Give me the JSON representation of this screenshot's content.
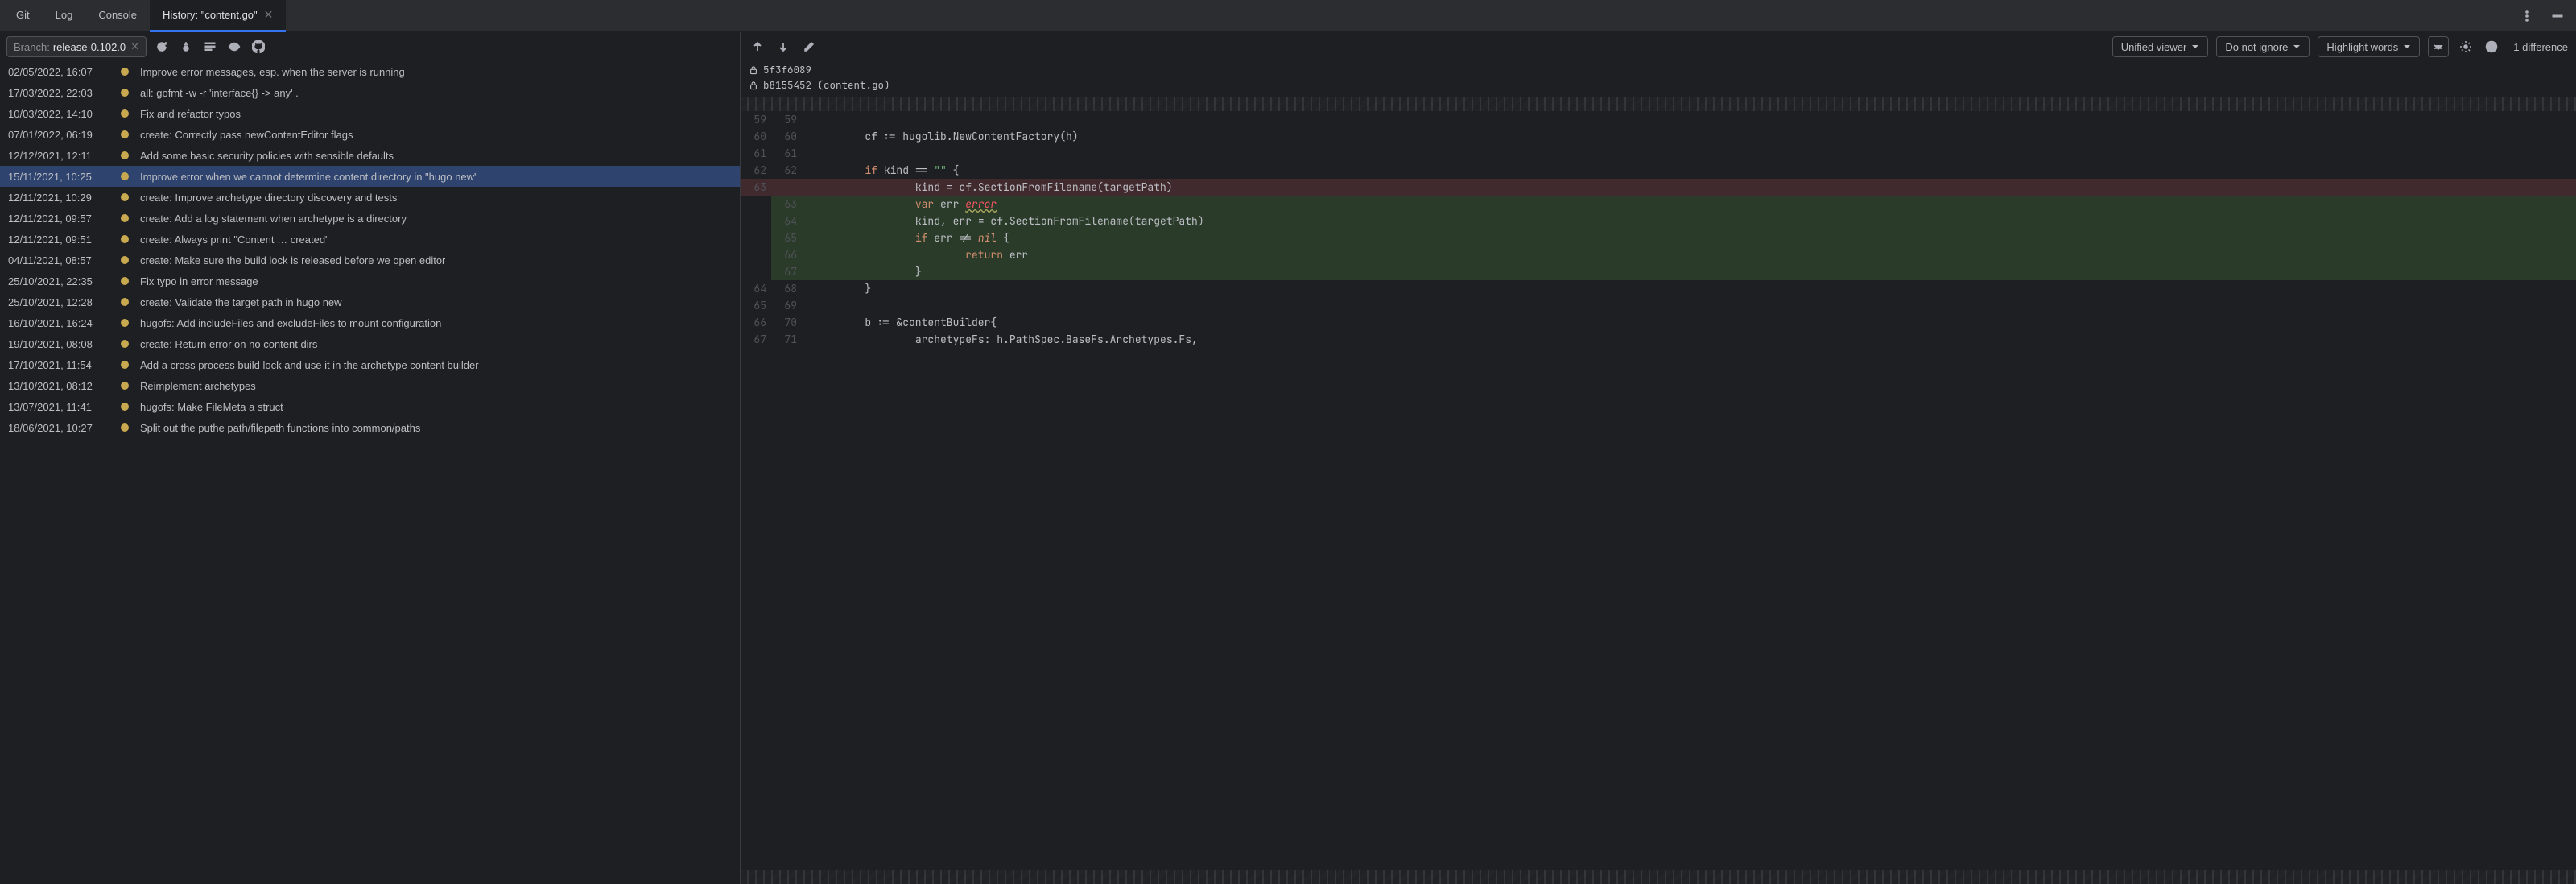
{
  "tabs": [
    {
      "label": "Git",
      "active": false
    },
    {
      "label": "Log",
      "active": false
    },
    {
      "label": "Console",
      "active": false
    },
    {
      "label": "History: \"content.go\"",
      "active": true,
      "closable": true
    }
  ],
  "branch": {
    "label": "Branch:",
    "name": "release-0.102.0"
  },
  "commits": [
    {
      "date": "02/05/2022, 16:07",
      "msg": "Improve error messages, esp. when the server is running"
    },
    {
      "date": "17/03/2022, 22:03",
      "msg": "all: gofmt -w -r 'interface{} -> any' ."
    },
    {
      "date": "10/03/2022, 14:10",
      "msg": "Fix and refactor typos"
    },
    {
      "date": "07/01/2022, 06:19",
      "msg": "create: Correctly pass newContentEditor flags"
    },
    {
      "date": "12/12/2021, 12:11",
      "msg": "Add some basic security policies with sensible defaults"
    },
    {
      "date": "15/11/2021, 10:25",
      "msg": "Improve error when we cannot determine content directory in \"hugo new\"",
      "selected": true
    },
    {
      "date": "12/11/2021, 10:29",
      "msg": "create: Improve archetype directory discovery and tests"
    },
    {
      "date": "12/11/2021, 09:57",
      "msg": "create: Add a log statement when archetype is a directory"
    },
    {
      "date": "12/11/2021, 09:51",
      "msg": "create: Always print \"Content … created\""
    },
    {
      "date": "04/11/2021, 08:57",
      "msg": "create: Make sure the build lock is released before we open editor"
    },
    {
      "date": "25/10/2021, 22:35",
      "msg": "Fix typo in error message"
    },
    {
      "date": "25/10/2021, 12:28",
      "msg": "create: Validate the target path in hugo new"
    },
    {
      "date": "16/10/2021, 16:24",
      "msg": "hugofs: Add includeFiles and excludeFiles to mount configuration"
    },
    {
      "date": "19/10/2021, 08:08",
      "msg": "create: Return error on no content dirs"
    },
    {
      "date": "17/10/2021, 11:54",
      "msg": "Add a cross process build lock and use it in the archetype content builder"
    },
    {
      "date": "13/10/2021, 08:12",
      "msg": "Reimplement archetypes"
    },
    {
      "date": "13/07/2021, 11:41",
      "msg": "hugofs: Make FileMeta a struct"
    },
    {
      "date": "18/06/2021, 10:27",
      "msg": "Split out the puthe path/filepath functions into common/paths"
    }
  ],
  "right_toolbar": {
    "viewer": "Unified viewer",
    "ignore": "Do not ignore",
    "highlight": "Highlight words",
    "diff_count": "1 difference"
  },
  "hashes": {
    "old": "5f3f6089",
    "new": "b8155452 (content.go)"
  },
  "diff_lines": [
    {
      "l": "59",
      "r": "59",
      "type": "ctx",
      "code": ""
    },
    {
      "l": "60",
      "r": "60",
      "type": "ctx",
      "code": "\tcf := hugolib.NewContentFactory(h)"
    },
    {
      "l": "61",
      "r": "61",
      "type": "ctx",
      "code": ""
    },
    {
      "l": "62",
      "r": "62",
      "type": "ctx",
      "code": "\tif kind == \"\" {",
      "tokens": [
        {
          "t": "\t",
          "c": ""
        },
        {
          "t": "if",
          "c": "tok-kw"
        },
        {
          "t": " kind == ",
          "c": ""
        },
        {
          "t": "\"\"",
          "c": "tok-str"
        },
        {
          "t": " {",
          "c": ""
        }
      ]
    },
    {
      "l": "63",
      "r": "",
      "type": "removed",
      "code": "\t\tkind = cf.SectionFromFilename(targetPath)"
    },
    {
      "l": "",
      "r": "63",
      "type": "added",
      "code": "\t\tvar err error",
      "tokens": [
        {
          "t": "\t\t",
          "c": ""
        },
        {
          "t": "var",
          "c": "tok-kw"
        },
        {
          "t": " err ",
          "c": ""
        },
        {
          "t": "error",
          "c": "tok-err"
        }
      ]
    },
    {
      "l": "",
      "r": "64",
      "type": "added",
      "code": "\t\tkind, err = cf.SectionFromFilename(targetPath)"
    },
    {
      "l": "",
      "r": "65",
      "type": "added",
      "code": "\t\tif err != nil {",
      "tokens": [
        {
          "t": "\t\t",
          "c": ""
        },
        {
          "t": "if",
          "c": "tok-kw"
        },
        {
          "t": " err != ",
          "c": ""
        },
        {
          "t": "nil",
          "c": "tok-nil"
        },
        {
          "t": " {",
          "c": ""
        }
      ]
    },
    {
      "l": "",
      "r": "66",
      "type": "added",
      "code": "\t\t\treturn err",
      "tokens": [
        {
          "t": "\t\t\t",
          "c": ""
        },
        {
          "t": "return",
          "c": "tok-kw"
        },
        {
          "t": " err",
          "c": ""
        }
      ]
    },
    {
      "l": "",
      "r": "67",
      "type": "added",
      "code": "\t\t}"
    },
    {
      "l": "64",
      "r": "68",
      "type": "ctx",
      "code": "\t}"
    },
    {
      "l": "65",
      "r": "69",
      "type": "ctx",
      "code": ""
    },
    {
      "l": "66",
      "r": "70",
      "type": "ctx",
      "code": "\tb := &contentBuilder{"
    },
    {
      "l": "67",
      "r": "71",
      "type": "ctx",
      "code": "\t\tarchetypeFs: h.PathSpec.BaseFs.Archetypes.Fs,"
    }
  ]
}
